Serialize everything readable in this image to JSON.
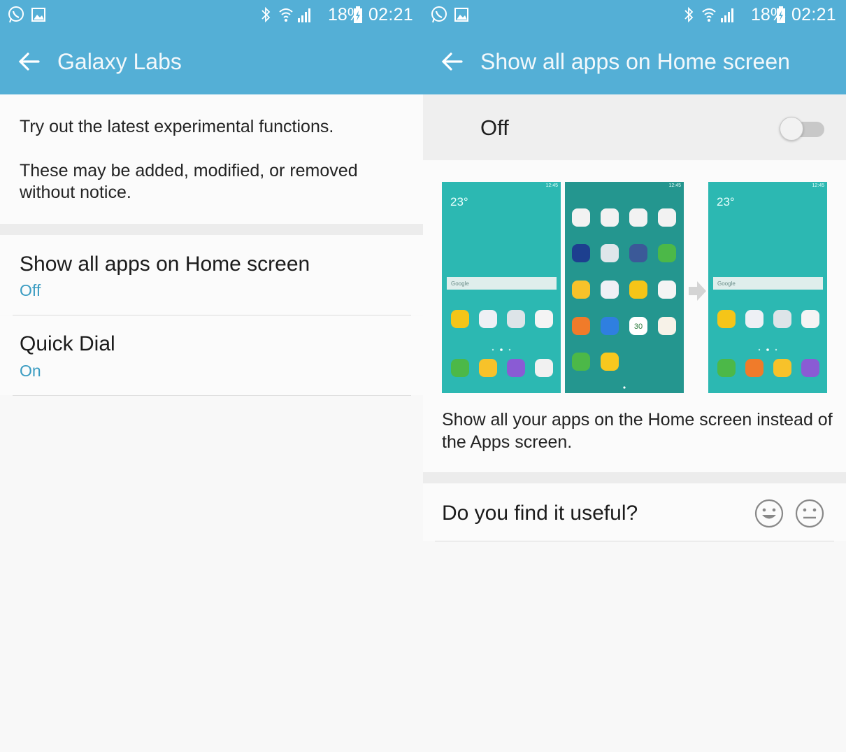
{
  "status_bar": {
    "battery_percent": "18%",
    "time": "02:21",
    "icons": [
      "whatsapp-icon",
      "gallery-icon",
      "bluetooth-icon",
      "wifi-icon",
      "signal-icon",
      "battery-charging-icon"
    ]
  },
  "left_screen": {
    "title": "Galaxy Labs",
    "intro_line1": "Try out the latest experimental functions.",
    "intro_line2": "These may be added, modified, or removed without notice.",
    "items": [
      {
        "title": "Show all apps on Home screen",
        "status": "Off"
      },
      {
        "title": "Quick Dial",
        "status": "On"
      }
    ]
  },
  "right_screen": {
    "title": "Show all apps on Home screen",
    "toggle_label": "Off",
    "toggle_on": false,
    "preview": {
      "phone_time": "12:45",
      "weather": "23°",
      "search_brand": "Google",
      "calendar_day": "30"
    },
    "description": "Show all your apps on the Home screen instead of the Apps screen.",
    "feedback_question": "Do you find it useful?"
  },
  "colors": {
    "header": "#54afd6",
    "accent": "#3a9cc2",
    "teal_home": "#2cb8b2",
    "teal_apps": "#24968f"
  }
}
